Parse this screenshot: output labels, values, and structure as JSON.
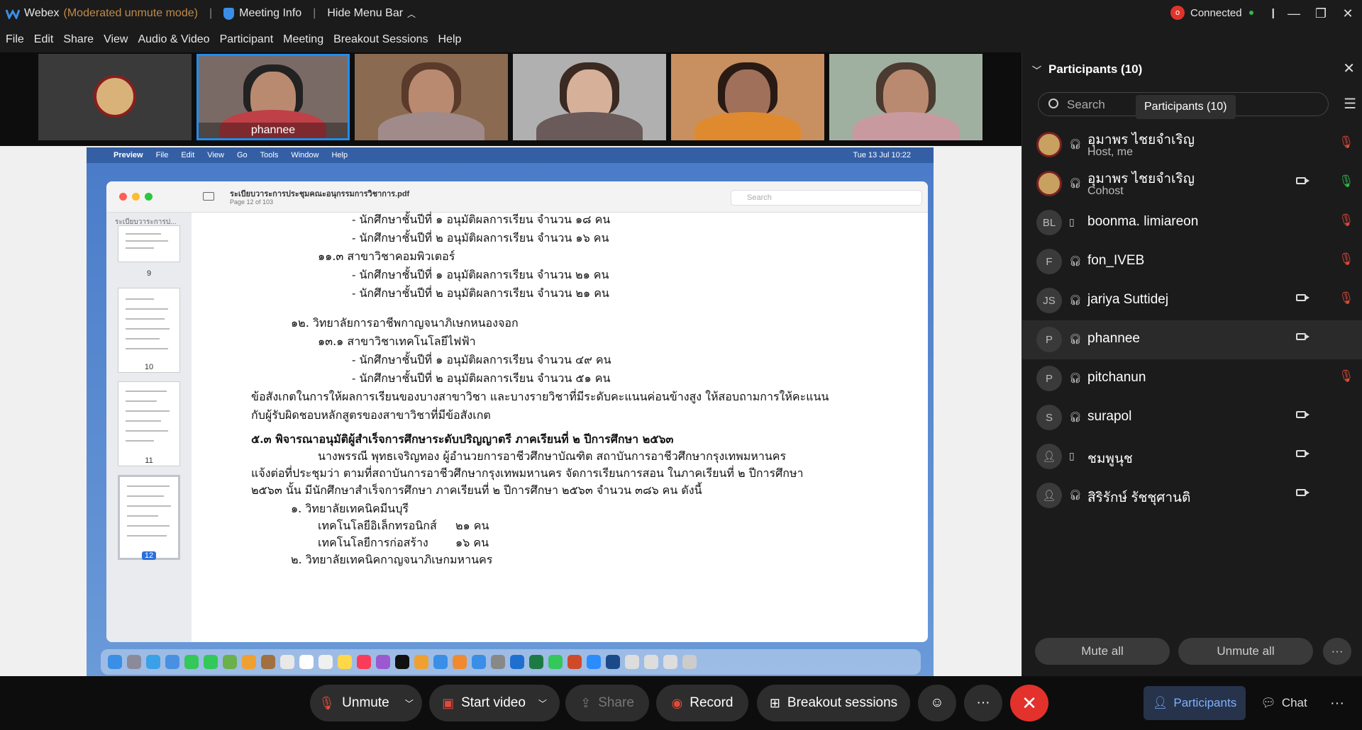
{
  "titlebar": {
    "app": "Webex",
    "mode": "(Moderated unmute mode)",
    "meeting_info": "Meeting Info",
    "hide_menu": "Hide Menu Bar",
    "status": "Connected"
  },
  "menu": [
    "File",
    "Edit",
    "Share",
    "View",
    "Audio & Video",
    "Participant",
    "Meeting",
    "Breakout Sessions",
    "Help"
  ],
  "video_strip": {
    "active_name": "phannee"
  },
  "shared_screen": {
    "mac_menu": [
      "Preview",
      "File",
      "Edit",
      "View",
      "Go",
      "Tools",
      "Window",
      "Help"
    ],
    "clock": "Tue 13 Jul  10:22",
    "pdf_title": "ระเบียบวาระการประชุมคณะอนุกรรมการวิชาการ.pdf",
    "pdf_page": "Page 12 of 103",
    "search_placeholder": "Search",
    "sidebar_title": "ระเบียบวาระการป...",
    "thumb_numbers": [
      "9",
      "10",
      "11",
      "12"
    ],
    "doc_lines": [
      "- นักศึกษาชั้นปีที่ ๑  อนุมัติผลการเรียน  จำนวน ๑๘ คน",
      "- นักศึกษาชั้นปีที่ ๒  อนุมัติผลการเรียน  จำนวน  ๑๖  คน",
      "๑๑.๓ สาขาวิชาคอมพิวเตอร์",
      "- นักศึกษาชั้นปีที่ ๑  อนุมัติผลการเรียน  จำนวน  ๒๑  คน",
      "- นักศึกษาชั้นปีที่ ๒  อนุมัติผลการเรียน  จำนวน  ๒๑  คน",
      "๑๒. วิทยาลัยการอาชีพกาญจนาภิเษกหนองจอก",
      "๑๓.๑ สาขาวิชาเทคโนโลยีไฟฟ้า",
      "- นักศึกษาชั้นปีที่ ๑  อนุมัติผลการเรียน  จำนวน  ๔๙  คน",
      "- นักศึกษาชั้นปีที่ ๒  อนุมัติผลการเรียน  จำนวน  ๕๑  คน",
      "ข้อสังเกตในการให้ผลการเรียนของบางสาขาวิชา และบางรายวิชาที่มีระดับคะแนนค่อนข้างสูง ให้สอบถามการให้คะแนน",
      "กับผู้รับผิดชอบหลักสูตรของสาขาวิชาที่มีข้อสังเกต",
      "๕.๓  พิจารณาอนุมัติผู้สำเร็จการศึกษาระดับปริญญาตรี ภาคเรียนที่ ๒ ปีการศึกษา ๒๕๖๓",
      "นางพรรณี  พุทธเจริญทอง  ผู้อำนวยการอาชีวศึกษาบัณฑิต สถาบันการอาชีวศึกษากรุงเทพมหานคร",
      "แจ้งต่อที่ประชุมว่า ตามที่สถาบันการอาชีวศึกษากรุงเทพมหานคร จัดการเรียนการสอน ในภาคเรียนที่ ๒ ปีการศึกษา",
      "๒๕๖๓ นั้น มีนักศึกษาสำเร็จการศึกษา ภาคเรียนที่ ๒ ปีการศึกษา ๒๕๖๓  จำนวน  ๓๘๖  คน ดังนี้",
      "๑.   วิทยาลัยเทคนิคมีนบุรี",
      "เทคโนโลยีอิเล็กทรอนิกส์",
      "๒๑  คน",
      "เทคโนโลยีการก่อสร้าง",
      "๑๖  คน",
      "๒.   วิทยาลัยเทคนิคกาญจนาภิเษกมหานคร"
    ]
  },
  "participants_panel": {
    "title": "Participants (10)",
    "search_placeholder": "Search",
    "tooltip": "Participants (10)",
    "people": [
      {
        "initials": "",
        "name": "อุมาพร ไชยจำเริญ",
        "sub": "Host, me",
        "video": false,
        "mic": "muted"
      },
      {
        "initials": "",
        "name": "อุมาพร ไชยจำเริญ",
        "sub": "Cohost",
        "video": true,
        "mic": "on"
      },
      {
        "initials": "BL",
        "name": "boonma. limiareon",
        "sub": "",
        "video": false,
        "mic": "muted"
      },
      {
        "initials": "F",
        "name": "fon_IVEB",
        "sub": "",
        "video": false,
        "mic": "muted"
      },
      {
        "initials": "JS",
        "name": "jariya Suttidej",
        "sub": "",
        "video": true,
        "mic": "muted"
      },
      {
        "initials": "P",
        "name": "phannee",
        "sub": "",
        "video": true,
        "mic": "none"
      },
      {
        "initials": "P",
        "name": "pitchanun",
        "sub": "",
        "video": false,
        "mic": "muted"
      },
      {
        "initials": "S",
        "name": "surapol",
        "sub": "",
        "video": true,
        "mic": "none"
      },
      {
        "initials": "",
        "name": "ชมพูนุช",
        "sub": "",
        "video": true,
        "mic": "none"
      },
      {
        "initials": "",
        "name": "สิริรักษ์ รัชชุศานติ",
        "sub": "",
        "video": true,
        "mic": "none"
      }
    ],
    "mute_all": "Mute all",
    "unmute_all": "Unmute all"
  },
  "toolbar": {
    "unmute": "Unmute",
    "start_video": "Start video",
    "share": "Share",
    "record": "Record",
    "breakout": "Breakout sessions",
    "participants": "Participants",
    "chat": "Chat"
  },
  "colors": {
    "accent": "#3b8ee8",
    "leave": "#e3312b",
    "muted": "#e04a3a",
    "active_tile_border": "#1f8ef1"
  }
}
